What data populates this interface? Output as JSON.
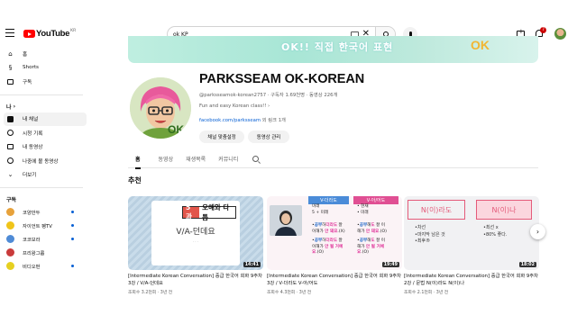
{
  "topbar": {
    "logo_text": "YouTube",
    "logo_region": "KR",
    "search_value": "ok KP",
    "icons": [
      "menu-icon",
      "keyboard-icon",
      "clear-icon",
      "search-icon",
      "mic-icon",
      "create-icon",
      "bell-icon"
    ],
    "notification_count": "7"
  },
  "sidebar": {
    "main": [
      {
        "label": "홈",
        "icon": "home-icon"
      },
      {
        "label": "Shorts",
        "icon": "shorts-icon"
      },
      {
        "label": "구독",
        "icon": "subscriptions-icon"
      }
    ],
    "me_header": "나",
    "me": [
      {
        "label": "내 채널",
        "icon": "channel-icon"
      },
      {
        "label": "시청 기록",
        "icon": "history-icon"
      },
      {
        "label": "내 동영상",
        "icon": "my-videos-icon"
      },
      {
        "label": "나중에 볼 동영상",
        "icon": "watch-later-icon"
      },
      {
        "label": "더보기",
        "icon": "chevron-down-icon"
      }
    ],
    "subs_header": "구독",
    "subs": [
      {
        "label": "코양만두",
        "color": "#e7a23b",
        "live": true
      },
      {
        "label": "자이언트 펭TV",
        "color": "#f0c419",
        "live": true
      },
      {
        "label": "코코보라",
        "color": "#4f8bd6",
        "live": true
      },
      {
        "label": "프리왕그룹",
        "color": "#c93b3b",
        "live": false
      },
      {
        "label": "비디오펀",
        "color": "#e6d020",
        "live": true
      }
    ]
  },
  "banner": {
    "text": "OK!! 직접 한국어 표현",
    "logo": "OK"
  },
  "channel": {
    "name": "PARKSSEAM OK-KOREAN",
    "handle": "@parksseamok-korean2757",
    "subscribers": "구독자 1.69천명",
    "videos": "동영상 226개",
    "description": "Fun and easy Korean class!!",
    "link_url": "facebook.com/parksseam",
    "link_more": "외 링크 1개",
    "btn_customize": "채널 맞춤설정",
    "btn_manage": "동영상 관리"
  },
  "tabs": [
    "홈",
    "동영상",
    "재생목록",
    "커뮤니티"
  ],
  "section_title": "추천",
  "videos": [
    {
      "title": "[Intermediate Korean Conversation] 중급 한국어 회화 9주차 3강 / V/A-던데요",
      "meta": "조회수 3.2천회 · 3년 전",
      "duration": "14:41",
      "thumb_number": "5과",
      "thumb_head": "오해와 다툼",
      "thumb_main": "V/A-던데요"
    },
    {
      "title": "[Intermediate Korean Conversation] 중급 한국어 회화 9주차 3강 / V-더라도 V-아/어도",
      "meta": "조회수 4.3천회 · 3년 전",
      "duration": "19:49",
      "col1_head": "V-더라도",
      "col2_head": "V-아/어도",
      "col1_rows": [
        "미래",
        "5 + 미래"
      ],
      "col2_rows": [
        "• 현재",
        "• 미래"
      ]
    },
    {
      "title": "[Intermediate Korean Conversation] 중급 한국어 회화 9주차 2강 / 문법 N(이)라도 N(이)나",
      "meta": "조회수 2.1천회 · 3년 전",
      "duration": "18:02",
      "box1": "N(이)라도",
      "box2": "N(이)나",
      "lines1": [
        "•차선",
        "•마지막 남은 것",
        "•최후®"
      ],
      "lines2": [
        "•최선 x",
        "•80% 좋다."
      ]
    }
  ]
}
